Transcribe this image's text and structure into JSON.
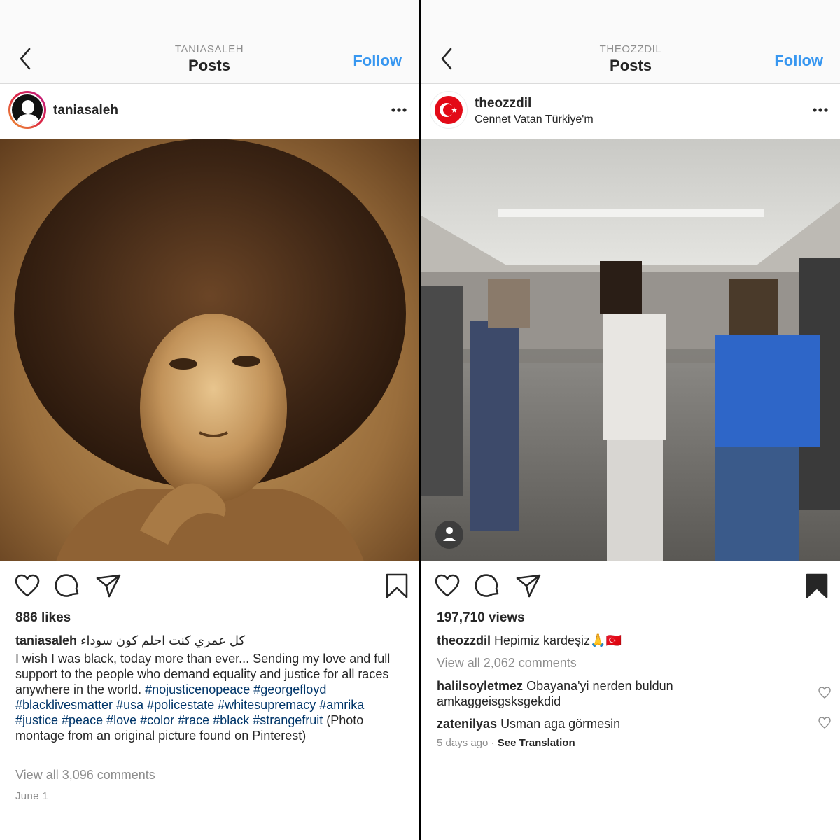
{
  "left": {
    "nav": {
      "account": "TANIASALEH",
      "title": "Posts",
      "follow": "Follow"
    },
    "post": {
      "username": "taniasaleh",
      "likes": "886 likes",
      "caption_user": "taniasaleh",
      "caption_arabic": "كل عمري كنت احلم كون سوداء",
      "caption_text": "I wish I was black, today more than ever... Sending my love and full support to the people who demand equality and justice for all races anywhere in the world.",
      "hashtags": "#nojusticenopeace #georgefloyd #blacklivesmatter #usa #policestate #whitesupremacy #amrika #justice #peace #love #color #race #black #strangefruit",
      "caption_tail": " (Photo montage from an original picture found on Pinterest)",
      "view_comments": "View all 3,096 comments",
      "date": "June 1",
      "saved": false
    }
  },
  "right": {
    "nav": {
      "account": "THEOZZDIL",
      "title": "Posts",
      "follow": "Follow"
    },
    "post": {
      "username": "theozzdil",
      "location": "Cennet Vatan Türkiye'm",
      "views": "197,710 views",
      "caption_user": "theozzdil",
      "caption_text": "Hepimiz kardeşiz🙏🇹🇷",
      "view_comments": "View all 2,062 comments",
      "comments": [
        {
          "user": "halilsoyletmez",
          "text": "Obayana'yi nerden buldun amkaggeisgsksgekdid"
        },
        {
          "user": "zatenilyas",
          "text": "Usman aga görmesin"
        }
      ],
      "time_ago": "5 days ago",
      "separator": "·",
      "see_translation": "See Translation",
      "saved": true
    }
  },
  "colors": {
    "link_blue": "#3897f0",
    "hashtag_blue": "#003569",
    "muted_gray": "#8e8e8e",
    "text": "#262626",
    "flag_red": "#e30a17"
  }
}
